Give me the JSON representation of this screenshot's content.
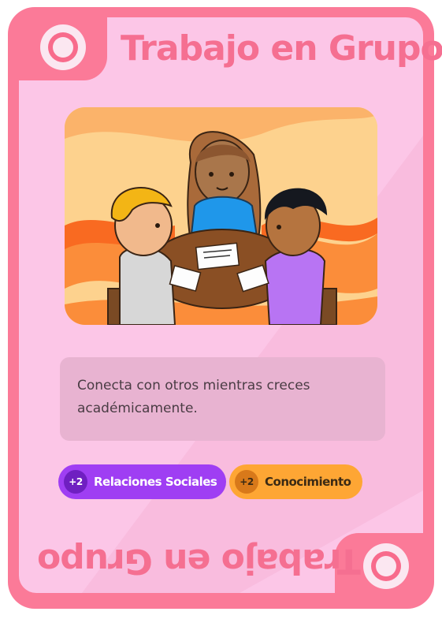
{
  "card": {
    "title": "Trabajo en Grupo",
    "title_mirrored": "Trabajo en Grupo",
    "description": "Conecta con otros mientras creces académicamente.",
    "image_alt_icon": "students-group-table-illustration",
    "stats": [
      {
        "badge": "+2",
        "label": "Relaciones Sociales",
        "color": "#9f3ef3"
      },
      {
        "badge": "+2",
        "label": "Conocimiento",
        "color": "#fea634"
      }
    ],
    "colors": {
      "frame": "#fb7a98",
      "background": "#fcc6e7",
      "title": "#f56f91"
    }
  }
}
